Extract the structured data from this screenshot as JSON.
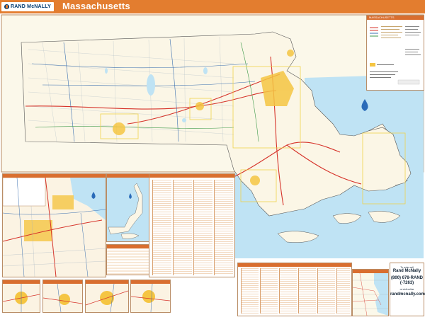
{
  "header": {
    "brand": "RAND McNALLY",
    "title": "Massachusetts"
  },
  "legend": {
    "title": "MASSACHUSETTS"
  },
  "contact": {
    "line1": "To order call",
    "company": "Rand McNally",
    "phone": "(800) 678-RAND",
    "phone_alt": "(-7263)",
    "line2": "or visit online",
    "website": "randmcnally.com"
  },
  "colors": {
    "header": "#e37d2f",
    "brand_blue": "#003a70",
    "land": "#fbf8ea",
    "water": "#bfe3f4",
    "urban": "#f5c542"
  }
}
